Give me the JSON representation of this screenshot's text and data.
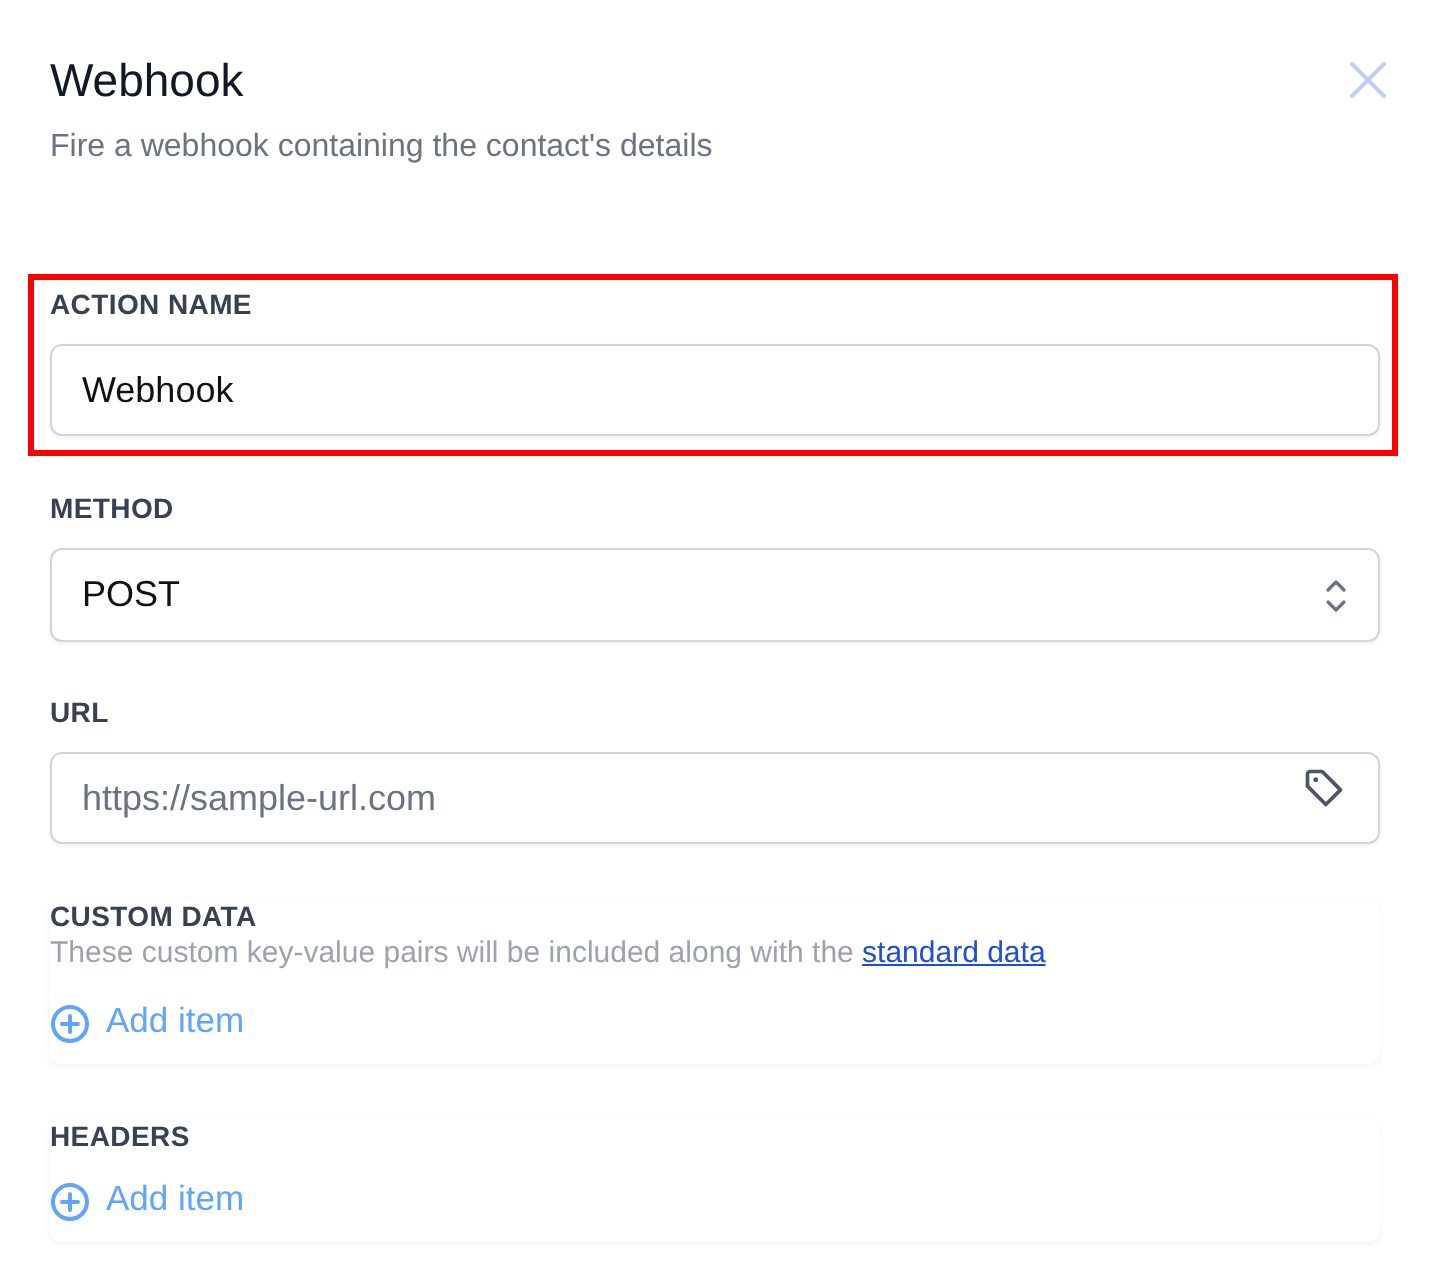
{
  "header": {
    "title": "Webhook",
    "subtitle": "Fire a webhook containing the contact's details"
  },
  "fields": [
    {
      "kind": "text",
      "label": "ACTION NAME",
      "value": "Webhook",
      "highlighted": true
    },
    {
      "kind": "select",
      "label": "METHOD",
      "value": "POST",
      "highlighted": false
    },
    {
      "kind": "tag-input",
      "label": "URL",
      "placeholder": "https://sample-url.com",
      "highlighted": false
    }
  ],
  "lists": [
    {
      "label": "CUSTOM DATA",
      "description": "These custom key-value pairs will be included along with the",
      "link": "standard data",
      "add_label": "Add item"
    },
    {
      "label": "HEADERS",
      "add_label": "Add item"
    }
  ]
}
